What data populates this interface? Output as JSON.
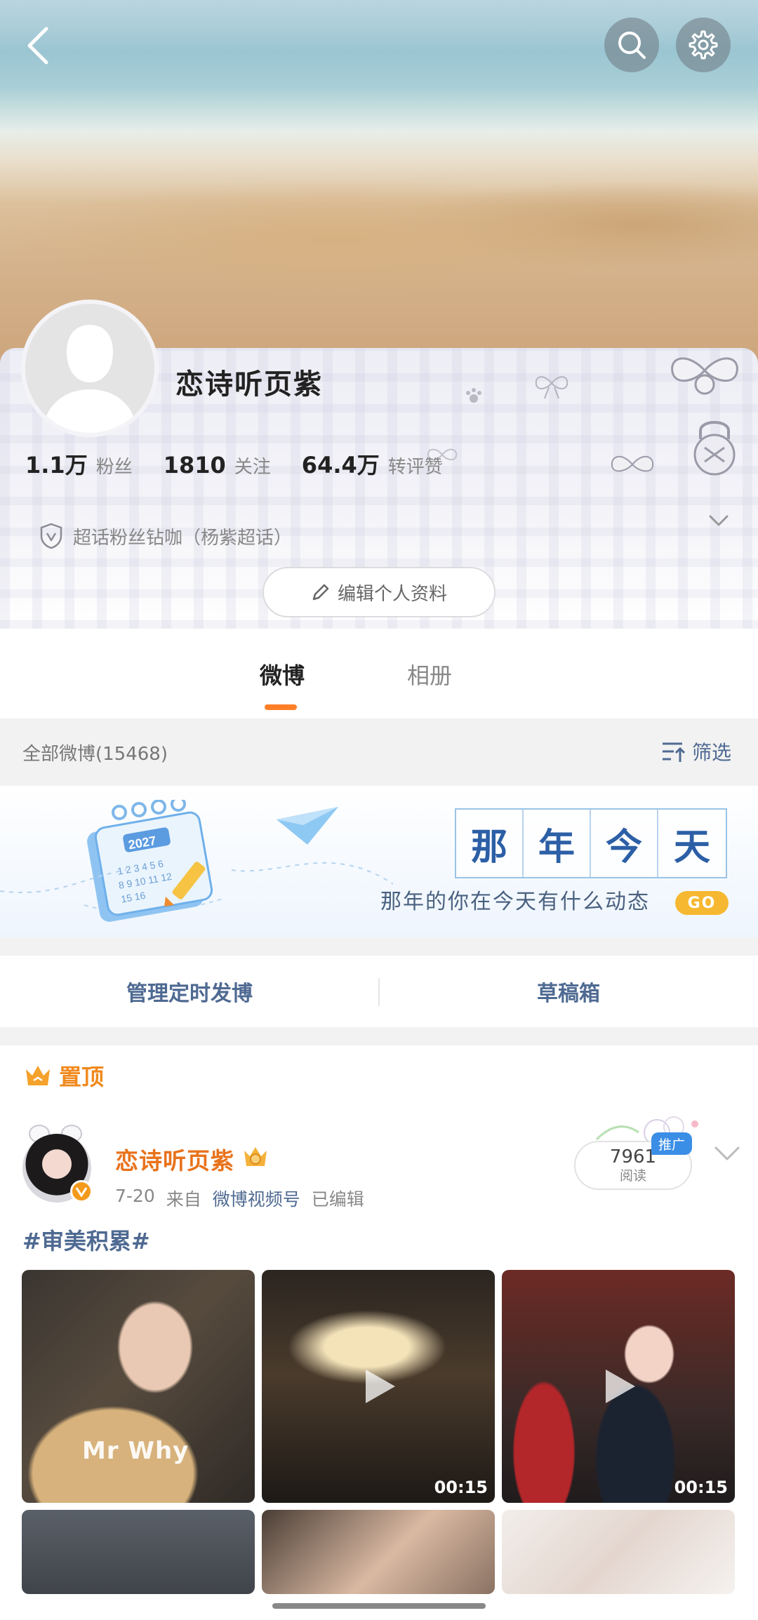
{
  "header": {
    "back_icon": "chevron-left-icon",
    "search_icon": "search-icon",
    "settings_icon": "gear-icon"
  },
  "profile": {
    "name": "恋诗听页紫",
    "stats": [
      {
        "value": "1.1万",
        "label": "粉丝"
      },
      {
        "value": "1810",
        "label": "关注"
      },
      {
        "value": "64.4万",
        "label": "转评赞"
      }
    ],
    "badge": "超话粉丝钻咖（杨紫超话）",
    "edit_label": "编辑个人资料"
  },
  "tabs": [
    {
      "label": "微博",
      "active": true
    },
    {
      "label": "相册",
      "active": false
    }
  ],
  "filter": {
    "count_label": "全部微博(15468)",
    "filter_label": "筛选"
  },
  "banner": {
    "title_chars": [
      "那",
      "年",
      "今",
      "天"
    ],
    "subtitle": "那年的你在今天有什么动态",
    "go_label": "GO",
    "calendar_year": "2027"
  },
  "actions": {
    "scheduled_label": "管理定时发博",
    "drafts_label": "草稿箱"
  },
  "post": {
    "pinned_label": "置顶",
    "author": "恋诗听页紫",
    "date": "7-20",
    "from_prefix": "来自",
    "source": "微博视频号",
    "edited": "已编辑",
    "read_count": "7961",
    "read_label": "阅读",
    "promo_label": "推广",
    "hashtag": "#审美积累#",
    "media": [
      {
        "type": "image",
        "watermark": "Mr Why"
      },
      {
        "type": "video",
        "duration": "00:15"
      },
      {
        "type": "video",
        "duration": "00:15"
      },
      {
        "type": "image"
      },
      {
        "type": "image"
      },
      {
        "type": "image"
      }
    ]
  },
  "colors": {
    "accent": "#ff7f28",
    "link": "#4f6a92",
    "name_orange": "#e8721b",
    "go_yellow": "#f6b830"
  }
}
